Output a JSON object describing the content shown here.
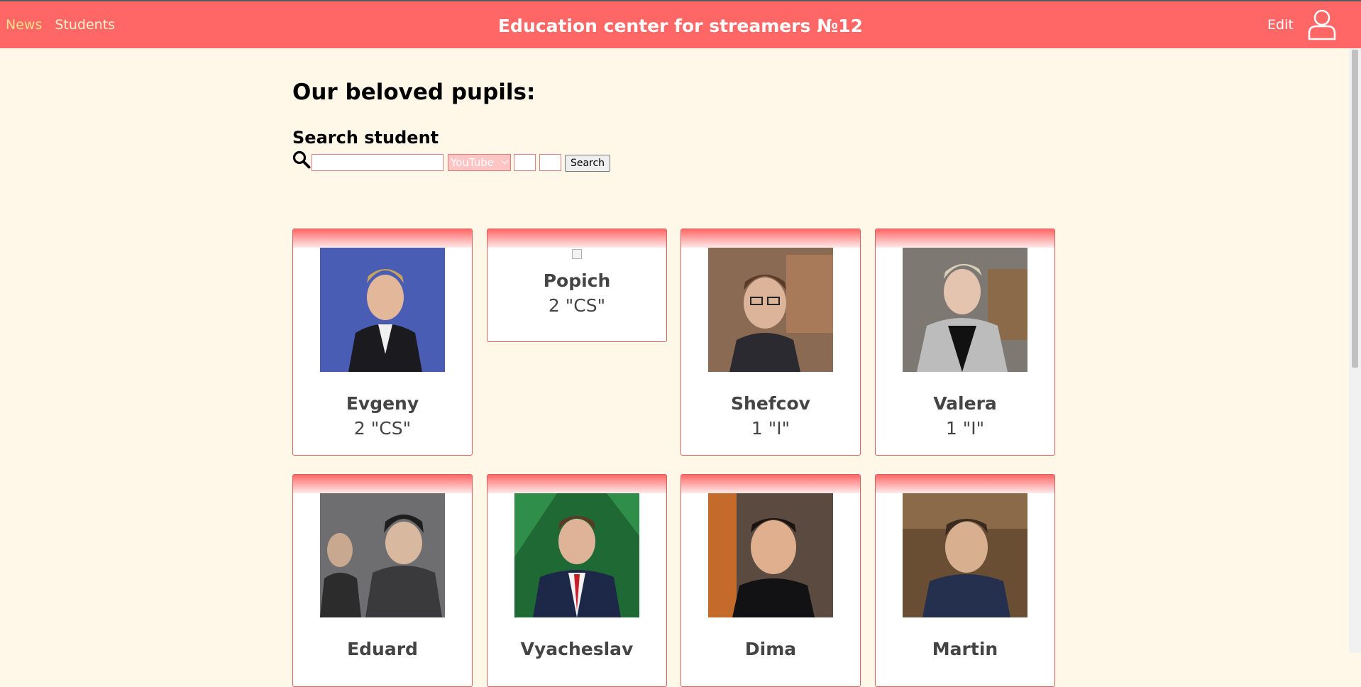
{
  "nav": {
    "links": [
      "News",
      "Students"
    ],
    "site_title": "Education center for streamers №12",
    "edit_label": "Edit",
    "user_icon": "user-icon"
  },
  "page": {
    "heading": "Our beloved pupils:"
  },
  "search": {
    "heading": "Search student",
    "icon": "search-icon",
    "query_value": "",
    "platform_selected": "YouTube",
    "button_label": "Search"
  },
  "students": [
    {
      "name": "Evgeny",
      "class": "2 \"CS\"",
      "photo": "photo"
    },
    {
      "name": "Popich",
      "class": "2 \"CS\"",
      "photo": "broken-image"
    },
    {
      "name": "Shefcov",
      "class": "1 \"I\"",
      "photo": "photo"
    },
    {
      "name": "Valera",
      "class": "1 \"I\"",
      "photo": "photo"
    },
    {
      "name": "Eduard",
      "class": "",
      "photo": "photo"
    },
    {
      "name": "Vyacheslav",
      "class": "",
      "photo": "photo"
    },
    {
      "name": "Dima",
      "class": "",
      "photo": "photo"
    },
    {
      "name": "Martin",
      "class": "",
      "photo": "photo"
    }
  ],
  "colors": {
    "accent": "#fe6766",
    "background": "#fff7e8",
    "card_border": "#e05e5e"
  }
}
